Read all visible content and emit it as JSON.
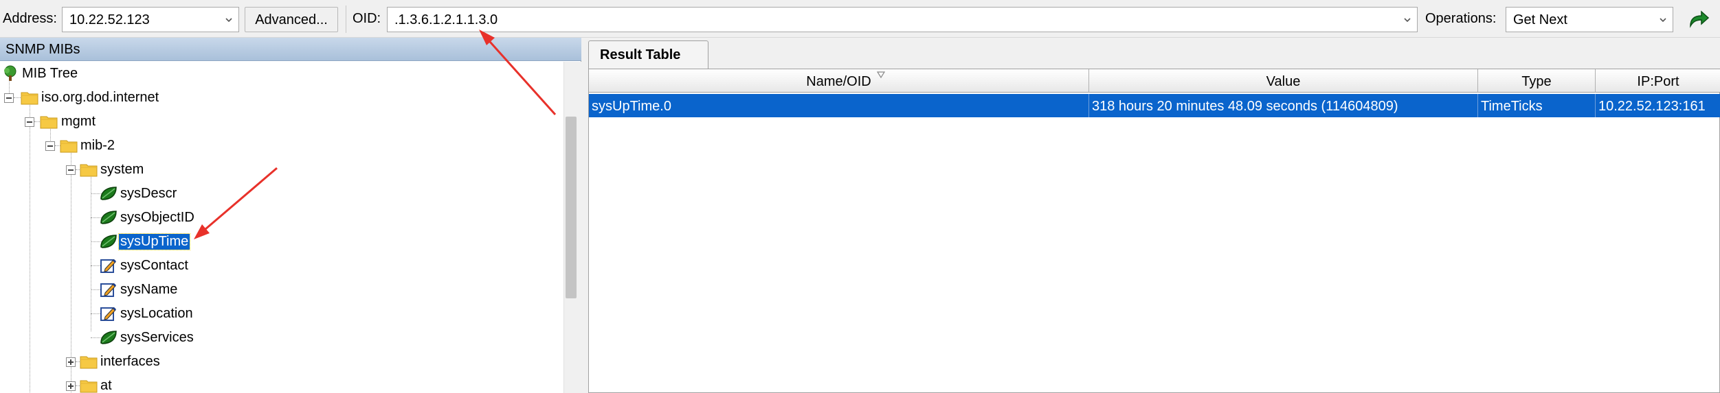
{
  "toolbar": {
    "address_label": "Address:",
    "address_value": "10.22.52.123",
    "advanced_label": "Advanced...",
    "oid_label": "OID:",
    "oid_value": ".1.3.6.1.2.1.1.3.0",
    "operations_label": "Operations:",
    "operations_value": "Get Next"
  },
  "left_panel": {
    "title": "SNMP MIBs",
    "tree": {
      "root": "MIB Tree",
      "iso": "iso.org.dod.internet",
      "mgmt": "mgmt",
      "mib2": "mib-2",
      "system": "system",
      "sysDescr": "sysDescr",
      "sysObjectID": "sysObjectID",
      "sysUpTime": "sysUpTime",
      "sysContact": "sysContact",
      "sysName": "sysName",
      "sysLocation": "sysLocation",
      "sysServices": "sysServices",
      "interfaces": "interfaces",
      "at": "at"
    }
  },
  "right_panel": {
    "tab_label": "Result Table",
    "columns": {
      "name": "Name/OID",
      "value": "Value",
      "type": "Type",
      "ipport": "IP:Port"
    },
    "rows": [
      {
        "name": "sysUpTime.0",
        "value": "318 hours 20 minutes 48.09 seconds (114604809)",
        "type": "TimeTicks",
        "ipport": "10.22.52.123:161"
      }
    ]
  },
  "colors": {
    "selection": "#0a64cc",
    "annotation_arrow": "#e8312a",
    "panel_header": "#b7cbe1"
  },
  "icons": {
    "tree_root": "tree-icon",
    "folder": "folder-icon",
    "leaf_readonly": "leaf-icon",
    "leaf_writable": "edit-icon",
    "go_button": "go-arrow-icon"
  }
}
